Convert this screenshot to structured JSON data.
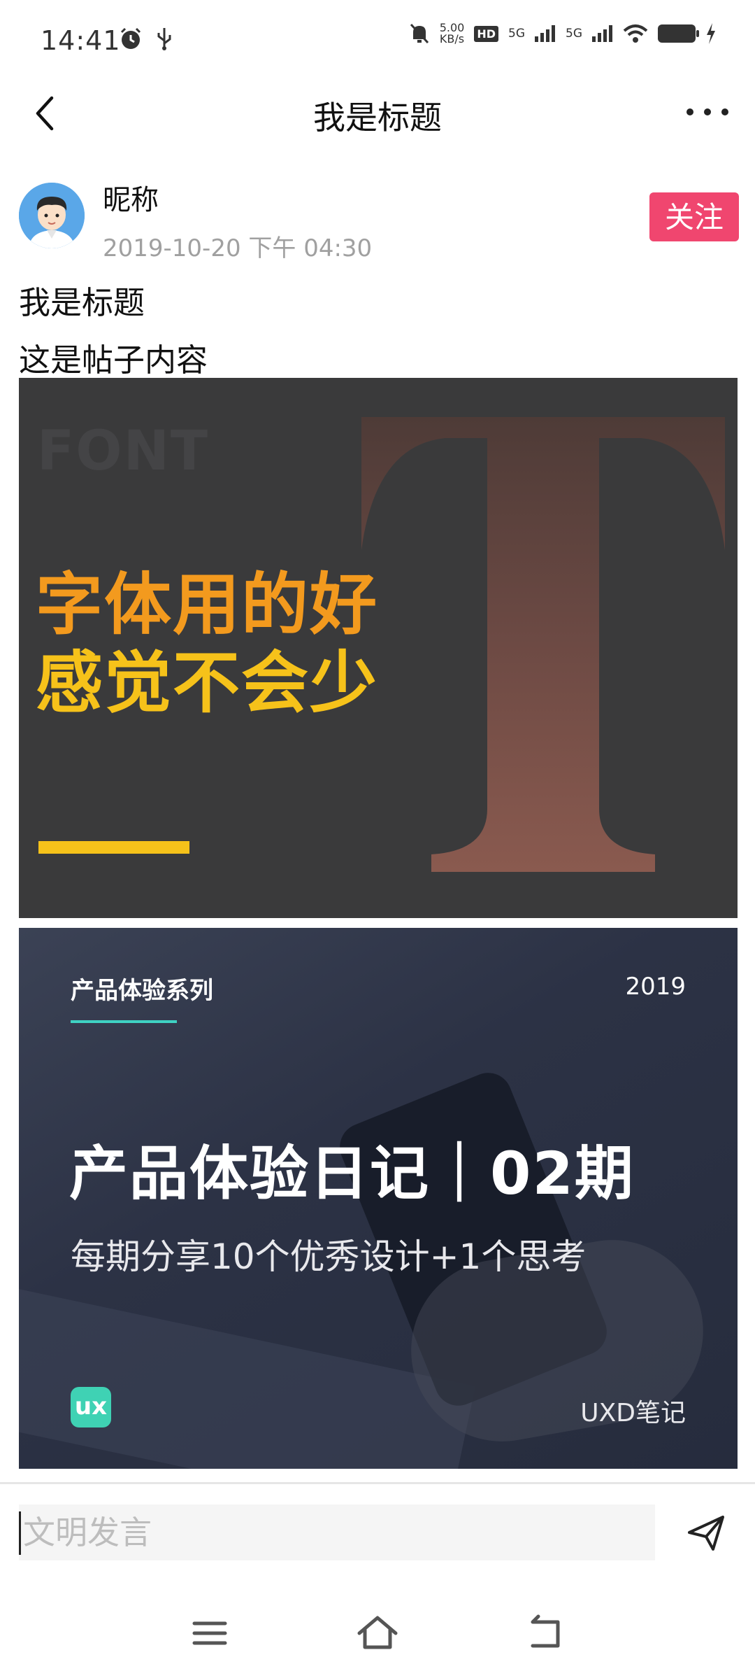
{
  "status_bar": {
    "time": "14:41",
    "speed_value": "5.00",
    "speed_unit": "KB/s",
    "hd_label": "HD",
    "sim1_label": "5G",
    "sim2_label": "5G",
    "left_icons": [
      "alarm-icon",
      "usb-icon"
    ],
    "right_icons": [
      "mute-icon",
      "signal-icon",
      "wifi-icon",
      "battery-icon",
      "charging-icon"
    ]
  },
  "nav": {
    "title": "我是标题",
    "back_icon": "chevron-left-icon",
    "more_icon": "more-dots-icon"
  },
  "author": {
    "nickname": "昵称",
    "date": "2019-10-20 下午 04:30",
    "follow_label": "关注"
  },
  "post": {
    "title": "我是标题",
    "content": "这是帖子内容",
    "image1": {
      "corner_word": "FONT",
      "big_letter": "T",
      "headline_line1": "字体用的好",
      "headline_line2": "感觉不会少"
    },
    "image2": {
      "series": "产品体验系列",
      "year": "2019",
      "main": "产品体验日记｜02期",
      "sub": "每期分享10个优秀设计+1个思考",
      "logo": "ux",
      "brand": "UXD笔记"
    }
  },
  "comment": {
    "placeholder": "文明发言",
    "send_icon": "send-icon"
  },
  "system_nav": [
    "menu-icon",
    "home-icon",
    "back-icon"
  ],
  "colors": {
    "follow_bg": "#f0466f",
    "image1_bg": "#3a3a3b",
    "headline_orange": "#f39a1e",
    "headline_yellow": "#f6c21a",
    "accent_teal": "#3fd2c3"
  }
}
